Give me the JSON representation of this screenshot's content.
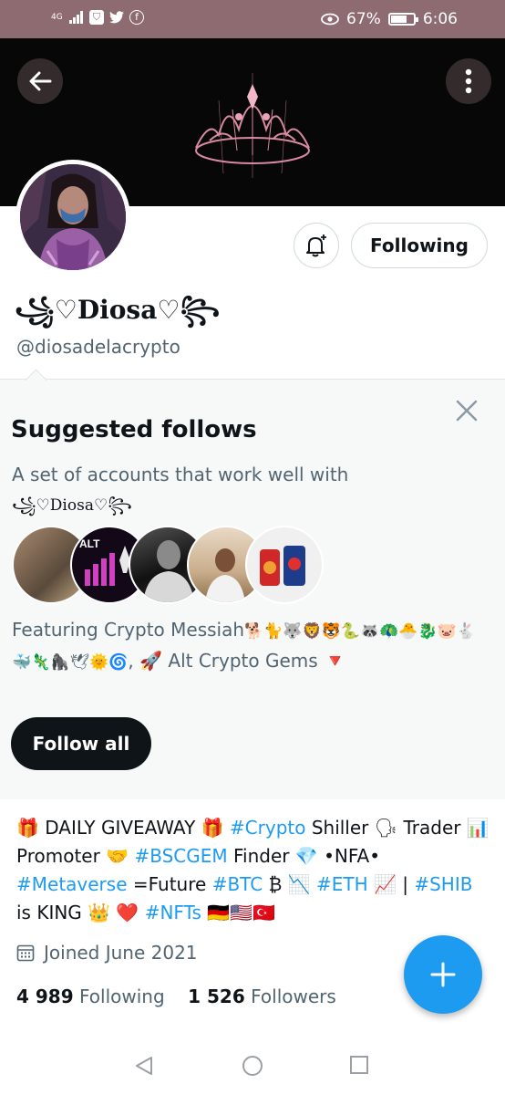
{
  "status_bar": {
    "network": "4G",
    "battery": "67%",
    "battery_level": 0.67,
    "time": "6:06"
  },
  "profile": {
    "display_name": "꧁♡Diosa♡꧂",
    "handle": "@diosadelacrypto",
    "following_button": "Following"
  },
  "suggested": {
    "title": "Suggested follows",
    "subtitle": "A set of accounts that work well with",
    "subtitle_name": "꧁♡Diosa♡꧂",
    "featuring_prefix": "Featuring Crypto Messiah",
    "featuring_emojis": "🐕🐈🐺🦁🐯🐍🦝🦚🐣🐉🐷🐇🐳🦎🦍🕊🌞🌀",
    "featuring_suffix": ", 🚀 Alt Crypto Gems 🔻",
    "follow_all": "Follow all"
  },
  "bio": {
    "t1": "🎁 DAILY GIVEAWAY 🎁 ",
    "tag_crypto": "#Crypto",
    "t2": " Shiller 🗣 Trader 📊 Promoter 🤝 ",
    "tag_bscgem": "#BSCGEM",
    "t3": " Finder 💎 •NFA• ",
    "tag_metaverse": "#Metaverse",
    "t4": " =Future ",
    "tag_btc": "#BTC",
    "t5": " ₿ 📉 ",
    "tag_eth": "#ETH",
    "t6": " 📈 | ",
    "tag_shib": "#SHIB",
    "t7": " is KING 👑 ❤️ ",
    "tag_nfts": "#NFTs",
    "t8": " 🇩🇪🇺🇸🇹🇷"
  },
  "joined": "Joined June 2021",
  "stats": {
    "following_count": "4 989",
    "following_label": "Following",
    "followers_count": "1 526",
    "followers_label": "Followers"
  },
  "colors": {
    "accent": "#1d9bf0",
    "status_bar": "#8e6b70",
    "text": "#0f1419",
    "muted": "#536471"
  }
}
